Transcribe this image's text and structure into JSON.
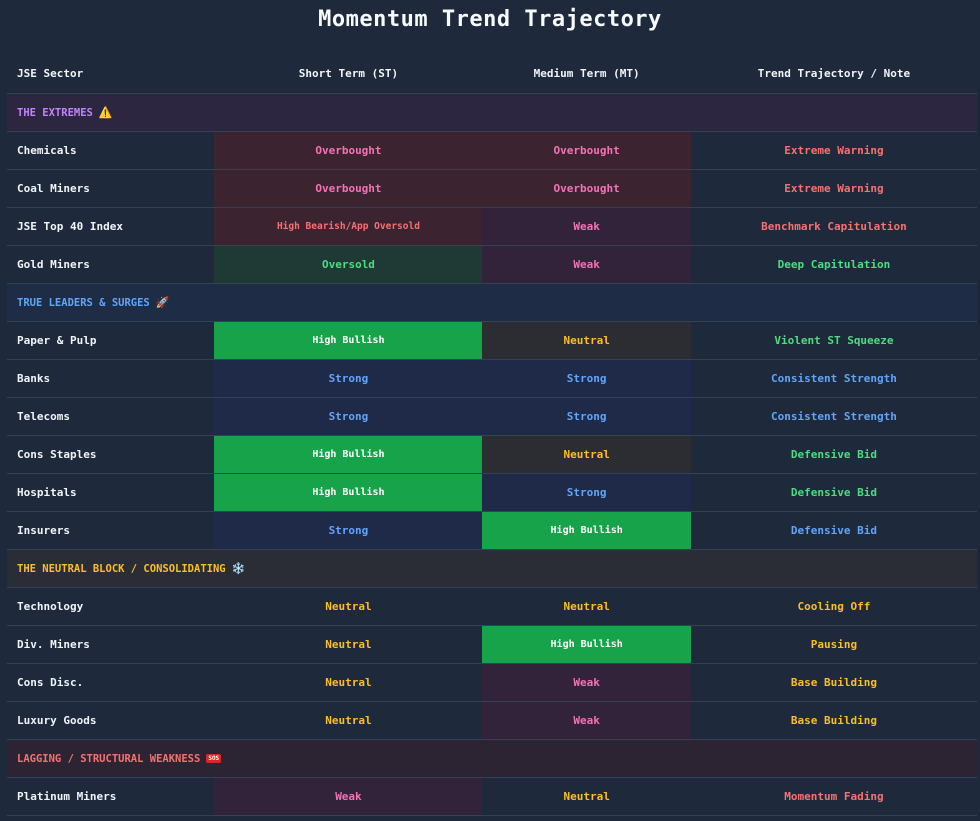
{
  "title": "Momentum Trend Trajectory",
  "headers": {
    "sector": "JSE Sector",
    "st": "Short Term (ST)",
    "mt": "Medium Term (MT)",
    "note": "Trend Trajectory / Note"
  },
  "sections": {
    "extremes": {
      "label": "THE EXTREMES",
      "icon": "warning-icon"
    },
    "leaders": {
      "label": "TRUE LEADERS & SURGES",
      "icon": "rocket-icon"
    },
    "neutral": {
      "label": "THE NEUTRAL BLOCK / CONSOLIDATING",
      "icon": "snowflake-icon"
    },
    "lagging": {
      "label": "LAGGING / STRUCTURAL WEAKNESS",
      "icon": "sos-icon",
      "icon_text": "SOS"
    }
  },
  "rows": [
    {
      "sector": "Chemicals",
      "st": "Overbought",
      "mt": "Overbought",
      "note": "Extreme Warning"
    },
    {
      "sector": "Coal Miners",
      "st": "Overbought",
      "mt": "Overbought",
      "note": "Extreme Warning"
    },
    {
      "sector": "JSE Top 40 Index",
      "st": "High Bearish/App Oversold",
      "mt": "Weak",
      "note": "Benchmark Capitulation"
    },
    {
      "sector": "Gold Miners",
      "st": "Oversold",
      "mt": "Weak",
      "note": "Deep Capitulation"
    },
    {
      "sector": "Paper & Pulp",
      "st": "High Bullish",
      "mt": "Neutral",
      "note": "Violent ST Squeeze"
    },
    {
      "sector": "Banks",
      "st": "Strong",
      "mt": "Strong",
      "note": "Consistent Strength"
    },
    {
      "sector": "Telecoms",
      "st": "Strong",
      "mt": "Strong",
      "note": "Consistent Strength"
    },
    {
      "sector": "Cons Staples",
      "st": "High Bullish",
      "mt": "Neutral",
      "note": "Defensive Bid"
    },
    {
      "sector": "Hospitals",
      "st": "High Bullish",
      "mt": "Strong",
      "note": "Defensive Bid"
    },
    {
      "sector": "Insurers",
      "st": "Strong",
      "mt": "High Bullish",
      "note": "Defensive Bid"
    },
    {
      "sector": "Technology",
      "st": "Neutral",
      "mt": "Neutral",
      "note": "Cooling Off"
    },
    {
      "sector": "Div. Miners",
      "st": "Neutral",
      "mt": "High Bullish",
      "note": "Pausing"
    },
    {
      "sector": "Cons Disc.",
      "st": "Neutral",
      "mt": "Weak",
      "note": "Base Building"
    },
    {
      "sector": "Luxury Goods",
      "st": "Neutral",
      "mt": "Weak",
      "note": "Base Building"
    },
    {
      "sector": "Platinum Miners",
      "st": "Weak",
      "mt": "Neutral",
      "note": "Momentum Fading"
    }
  ],
  "colors": {
    "background": "#1e293b",
    "high_bullish": "#16a34a",
    "strong_text": "#60a5fa",
    "weak_text": "#f472b6",
    "neutral_text": "#fbbf24",
    "oversold_text": "#4ade80",
    "warning_text": "#f87171"
  }
}
